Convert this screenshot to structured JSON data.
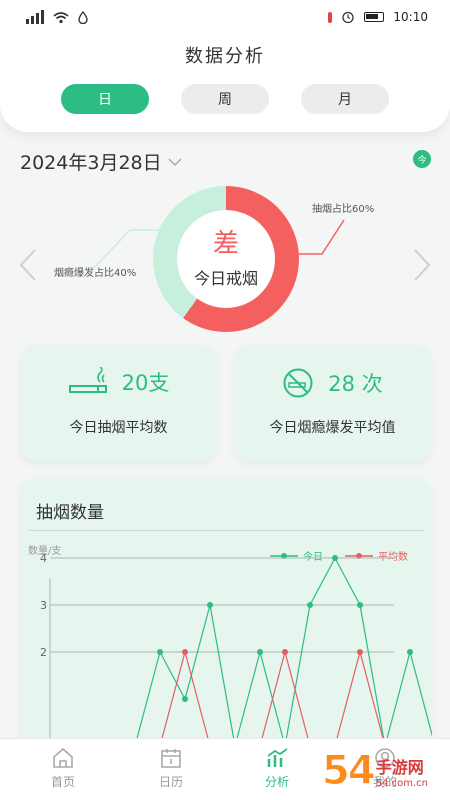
{
  "status_bar": {
    "time": "10:10",
    "icons": [
      "signal-icon",
      "wifi-icon",
      "drop-icon",
      "thermometer-icon",
      "alarm-icon",
      "battery-icon"
    ]
  },
  "header": {
    "title": "数据分析",
    "tabs": [
      {
        "label": "日",
        "active": true
      },
      {
        "label": "周",
        "active": false
      },
      {
        "label": "月",
        "active": false
      }
    ]
  },
  "date_row": {
    "date": "2024年3月28日",
    "today_badge": "今"
  },
  "donut": {
    "grade": "差",
    "center_label": "今日戒烟",
    "segments": [
      {
        "label": "抽烟占比60%",
        "percent": 60,
        "color": "#f4605f"
      },
      {
        "label": "烟瘾爆发占比40%",
        "percent": 40,
        "color": "#c6efdc"
      }
    ]
  },
  "stats": [
    {
      "value": "20支",
      "caption": "今日抽烟平均数",
      "icon": "cigarette-icon"
    },
    {
      "value": "28 次",
      "caption": "今日烟瘾爆发平均值",
      "icon": "no-smoking-icon"
    }
  ],
  "chart_section": {
    "title": "抽烟数量"
  },
  "chart_data": {
    "type": "line",
    "ylabel": "数量/支",
    "y_ticks": [
      "4",
      "3",
      "2"
    ],
    "series": [
      {
        "name": "今日",
        "color": "#2bbd84",
        "points": [
          [
            0,
            0
          ],
          [
            1,
            0
          ],
          [
            2,
            2
          ],
          [
            3,
            1
          ],
          [
            4,
            3
          ],
          [
            5,
            0
          ],
          [
            6,
            2
          ],
          [
            7,
            0
          ],
          [
            8,
            3
          ],
          [
            9,
            4
          ],
          [
            10,
            3
          ],
          [
            11,
            0
          ],
          [
            12,
            2
          ],
          [
            13,
            0
          ]
        ]
      },
      {
        "name": "平均数",
        "color": "#e06060",
        "points": [
          [
            0,
            0
          ],
          [
            1,
            0
          ],
          [
            2,
            0
          ],
          [
            3,
            2
          ],
          [
            4,
            0
          ],
          [
            5,
            0
          ],
          [
            6,
            0
          ],
          [
            7,
            2
          ],
          [
            8,
            0
          ],
          [
            9,
            0
          ],
          [
            10,
            2
          ],
          [
            11,
            0
          ],
          [
            12,
            0
          ],
          [
            13,
            0
          ]
        ]
      }
    ]
  },
  "tabbar": {
    "items": [
      {
        "label": "首页",
        "icon": "home-icon",
        "active": false
      },
      {
        "label": "日历",
        "icon": "calendar-icon",
        "active": false
      },
      {
        "label": "分析",
        "icon": "chart-icon",
        "active": true
      },
      {
        "label": "我的",
        "icon": "profile-icon",
        "active": false
      }
    ]
  },
  "watermark": {
    "main": "54",
    "sub_top": "手游网",
    "sub_bottom": "54.com.cn"
  }
}
